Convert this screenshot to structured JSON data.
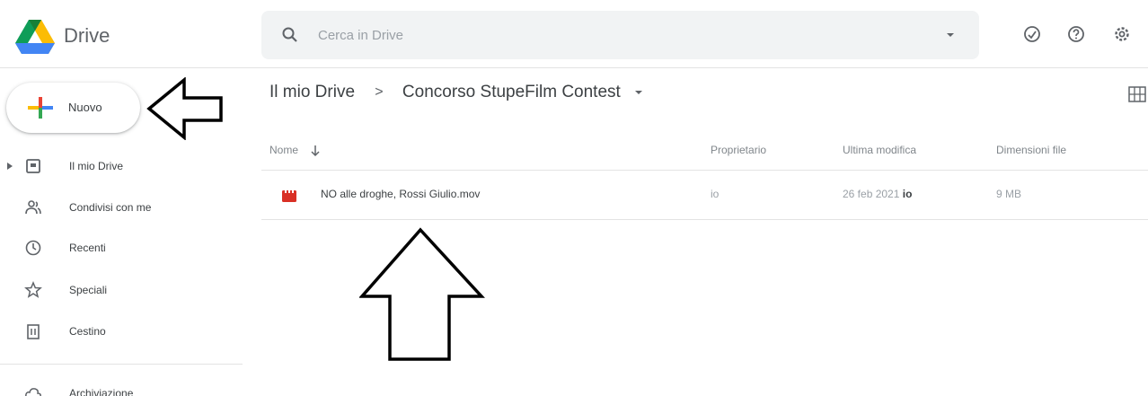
{
  "header": {
    "app_name": "Drive",
    "search": {
      "placeholder": "Cerca in Drive",
      "value": ""
    },
    "icons": [
      "logo-icon",
      "search-icon",
      "search-options-icon",
      "offline-status-icon",
      "help-icon",
      "settings-icon"
    ]
  },
  "sidebar": {
    "new_button": "Nuovo",
    "items": [
      {
        "label": "Il mio Drive",
        "icon": "my-drive-icon"
      },
      {
        "label": "Condivisi con me",
        "icon": "shared-icon"
      },
      {
        "label": "Recenti",
        "icon": "clock-icon"
      },
      {
        "label": "Speciali",
        "icon": "star-icon"
      },
      {
        "label": "Cestino",
        "icon": "trash-icon"
      },
      {
        "label": "Archiviazione",
        "icon": "cloud-icon"
      }
    ]
  },
  "breadcrumb": {
    "root": "Il mio Drive",
    "separator": ">",
    "current": "Concorso StupeFilm Contest"
  },
  "table": {
    "columns": {
      "name": "Nome",
      "owner": "Proprietario",
      "modified": "Ultima modifica",
      "size": "Dimensioni file"
    },
    "rows": [
      {
        "name": "NO alle droghe, Rossi Giulio.mov",
        "owner": "io",
        "modified_date": "26 feb 2021",
        "modified_by": "io",
        "size": "9 MB",
        "icon": "video-file-icon"
      }
    ]
  },
  "colors": {
    "accent_blue": "#1a73e8",
    "video_red": "#d93025",
    "search_bg": "#f1f3f4"
  }
}
